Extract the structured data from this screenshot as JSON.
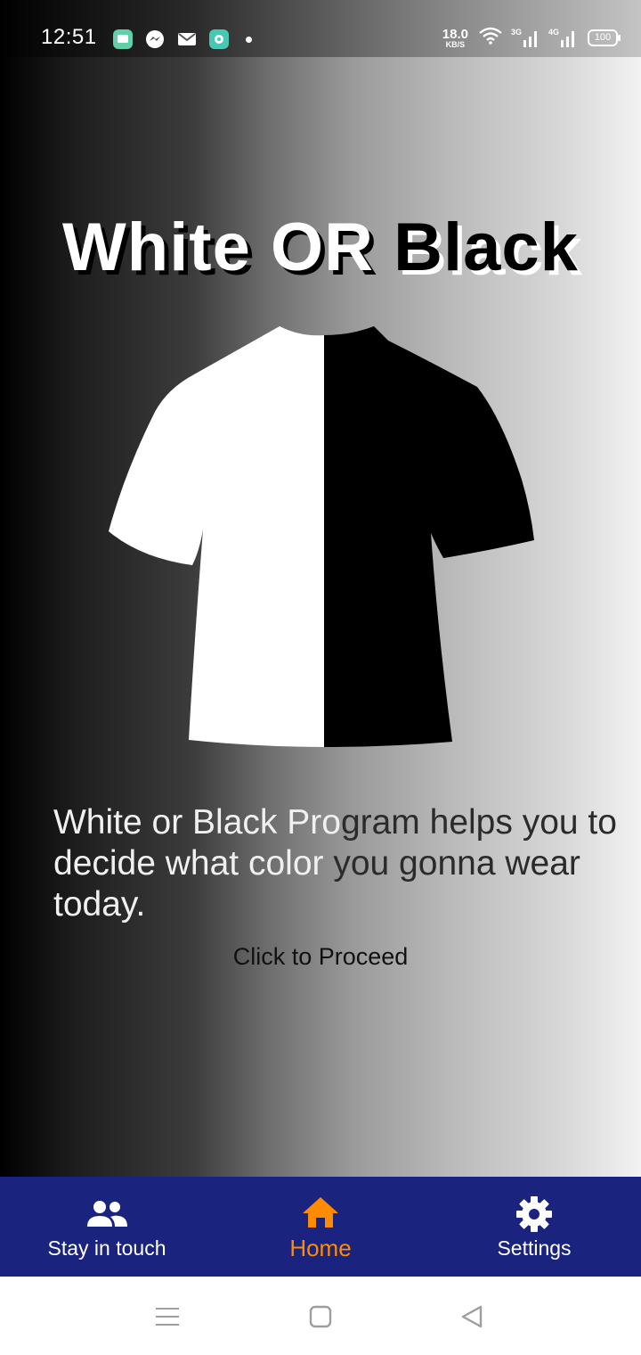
{
  "status_bar": {
    "time": "12:51",
    "net_speed_value": "18.0",
    "net_speed_unit": "KB/S",
    "signal_1_tag": "3G",
    "signal_2_tag": "4G",
    "battery": "100",
    "notification_icons": [
      "messages-icon",
      "messenger-icon",
      "mail-icon",
      "app-icon"
    ]
  },
  "main": {
    "title_white": "White",
    "title_or": "OR",
    "title_black": "Black",
    "description_light": "White or Black Pro",
    "description_dark_1": "gram helps you to",
    "description_light_2": "decide what color ",
    "description_dark_2": "you gonna wear",
    "description_light_3": "today.",
    "proceed_label": "Click to Proceed"
  },
  "bottom_nav": {
    "items": [
      {
        "label": "Stay in touch",
        "icon": "people-icon",
        "active": false
      },
      {
        "label": "Home",
        "icon": "home-icon",
        "active": true
      },
      {
        "label": "Settings",
        "icon": "gear-icon",
        "active": false
      }
    ],
    "active_color": "#ff8c00",
    "background": "#1a237e"
  },
  "system_nav": {
    "icons": [
      "menu-icon",
      "home-square-icon",
      "back-triangle-icon"
    ]
  }
}
